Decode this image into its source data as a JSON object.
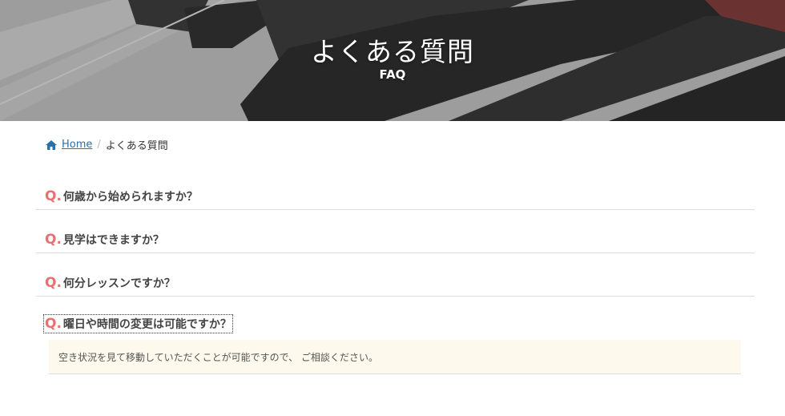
{
  "hero": {
    "title": "よくある質問",
    "subtitle": "FAQ"
  },
  "breadcrumb": {
    "home_label": "Home",
    "separator": "/",
    "current": "よくある質問"
  },
  "faq": {
    "q_prefix": "Q.",
    "items": [
      {
        "question": "何歳から始められますか？"
      },
      {
        "question": "見学はできますか？"
      },
      {
        "question": "何分レッスンですか？"
      },
      {
        "question": "曜日や時間の変更は可能ですか？",
        "answer": "空き状況を見て移動していただくことが可能ですので、 ご相談ください。"
      }
    ]
  },
  "colors": {
    "accent_q": "#e87070",
    "link": "#2a6fa8",
    "answer_bg": "#fdf9ec"
  }
}
